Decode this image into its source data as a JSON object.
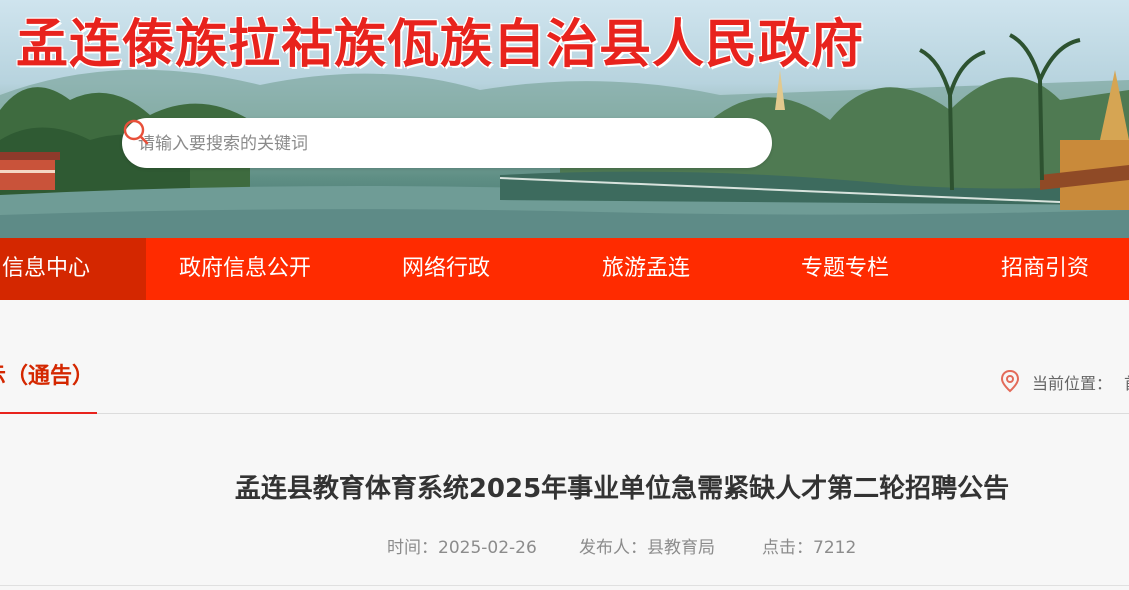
{
  "site": {
    "title": "孟连傣族拉祜族佤族自治县人民政府",
    "title_color": "#e8231d"
  },
  "search": {
    "placeholder": "请输入要搜索的关键词",
    "icon": "search-icon"
  },
  "nav": {
    "background": "#ff2b00",
    "active_background": "#d42700",
    "items": [
      {
        "label": "信息中心",
        "active": true
      },
      {
        "label": "政府信息公开",
        "active": false
      },
      {
        "label": "网络行政",
        "active": false
      },
      {
        "label": "旅游孟连",
        "active": false
      },
      {
        "label": "专题专栏",
        "active": false
      },
      {
        "label": "招商引资",
        "active": false
      }
    ]
  },
  "section": {
    "title": "示（通告）",
    "location_label": "当前位置：",
    "location_crumb": "首",
    "location_icon": "location-pin-icon"
  },
  "article": {
    "title": "孟连县教育体育系统2025年事业单位急需紧缺人才第二轮招聘公告",
    "time": "时间：2025-02-26",
    "publisher": "发布人：县教育局",
    "clicks": "点击：7212"
  }
}
